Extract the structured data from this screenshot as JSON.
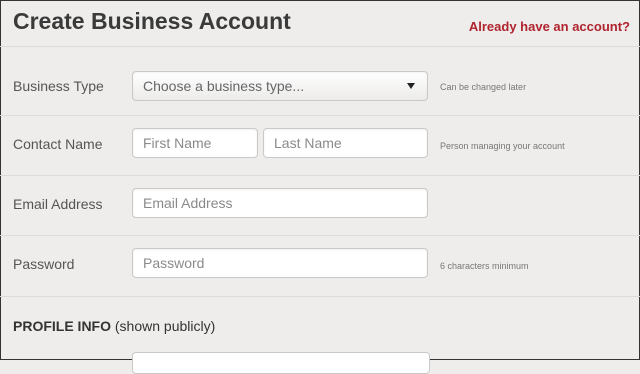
{
  "header": {
    "title": "Create Business Account",
    "login_link": "Already have an account?"
  },
  "form": {
    "business_type": {
      "label": "Business Type",
      "selected": "Choose a business type...",
      "hint": "Can be changed later"
    },
    "contact_name": {
      "label": "Contact Name",
      "first_placeholder": "First Name",
      "last_placeholder": "Last Name",
      "hint": "Person managing your account"
    },
    "email": {
      "label": "Email Address",
      "placeholder": "Email Address"
    },
    "password": {
      "label": "Password",
      "placeholder": "Password",
      "hint": "6 characters minimum"
    }
  },
  "profile_section": {
    "title_bold": "PROFILE INFO",
    "title_rest": " (shown publicly)"
  },
  "colors": {
    "accent_link": "#b0242e",
    "background": "#eeedeb"
  }
}
